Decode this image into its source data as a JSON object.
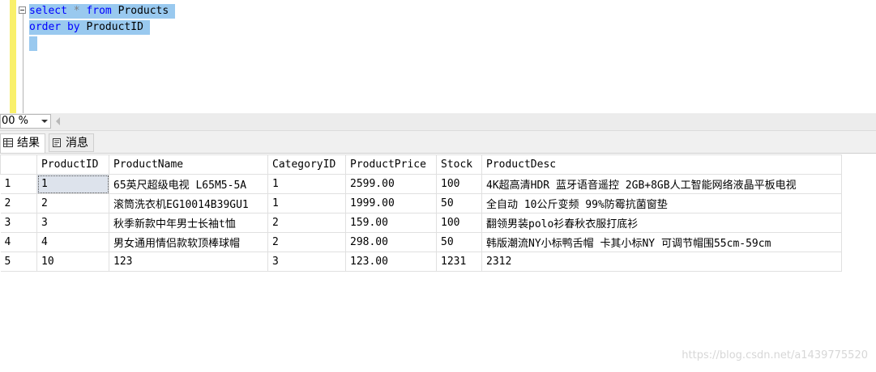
{
  "editor": {
    "lines": [
      {
        "kw1": "select",
        "op": "*",
        "kw2": "from",
        "ident": "Products"
      },
      {
        "kw1": "order by",
        "ident": "ProductID"
      }
    ]
  },
  "zoom": {
    "value": "00 %"
  },
  "tabs": [
    {
      "label": "结果",
      "icon": "grid-icon"
    },
    {
      "label": "消息",
      "icon": "message-icon"
    }
  ],
  "results": {
    "columns": [
      "ProductID",
      "ProductName",
      "CategoryID",
      "ProductPrice",
      "Stock",
      "ProductDesc"
    ],
    "rows": [
      {
        "num": "1",
        "cells": [
          "1",
          "65英尺超级电视 L65M5-5A",
          "1",
          "2599.00",
          "100",
          "4K超高清HDR 蓝牙语音遥控 2GB+8GB人工智能网络液晶平板电视"
        ]
      },
      {
        "num": "2",
        "cells": [
          "2",
          "滚筒洗衣机EG10014B39GU1",
          "1",
          "1999.00",
          "50",
          "全自动 10公斤变频 99%防霉抗菌窗垫"
        ]
      },
      {
        "num": "3",
        "cells": [
          "3",
          "秋季新款中年男士长袖t恤",
          "2",
          "159.00",
          "100",
          "翻领男装polo衫春秋衣服打底衫"
        ]
      },
      {
        "num": "4",
        "cells": [
          "4",
          "男女通用情侣款软顶棒球帽",
          "2",
          "298.00",
          "50",
          "韩版潮流NY小标鸭舌帽 卡其小标NY 可调节帽围55cm-59cm"
        ]
      },
      {
        "num": "5",
        "cells": [
          "10",
          "123",
          "3",
          "123.00",
          "1231",
          "2312"
        ]
      }
    ]
  },
  "watermark": "https://blog.csdn.net/a1439775520"
}
